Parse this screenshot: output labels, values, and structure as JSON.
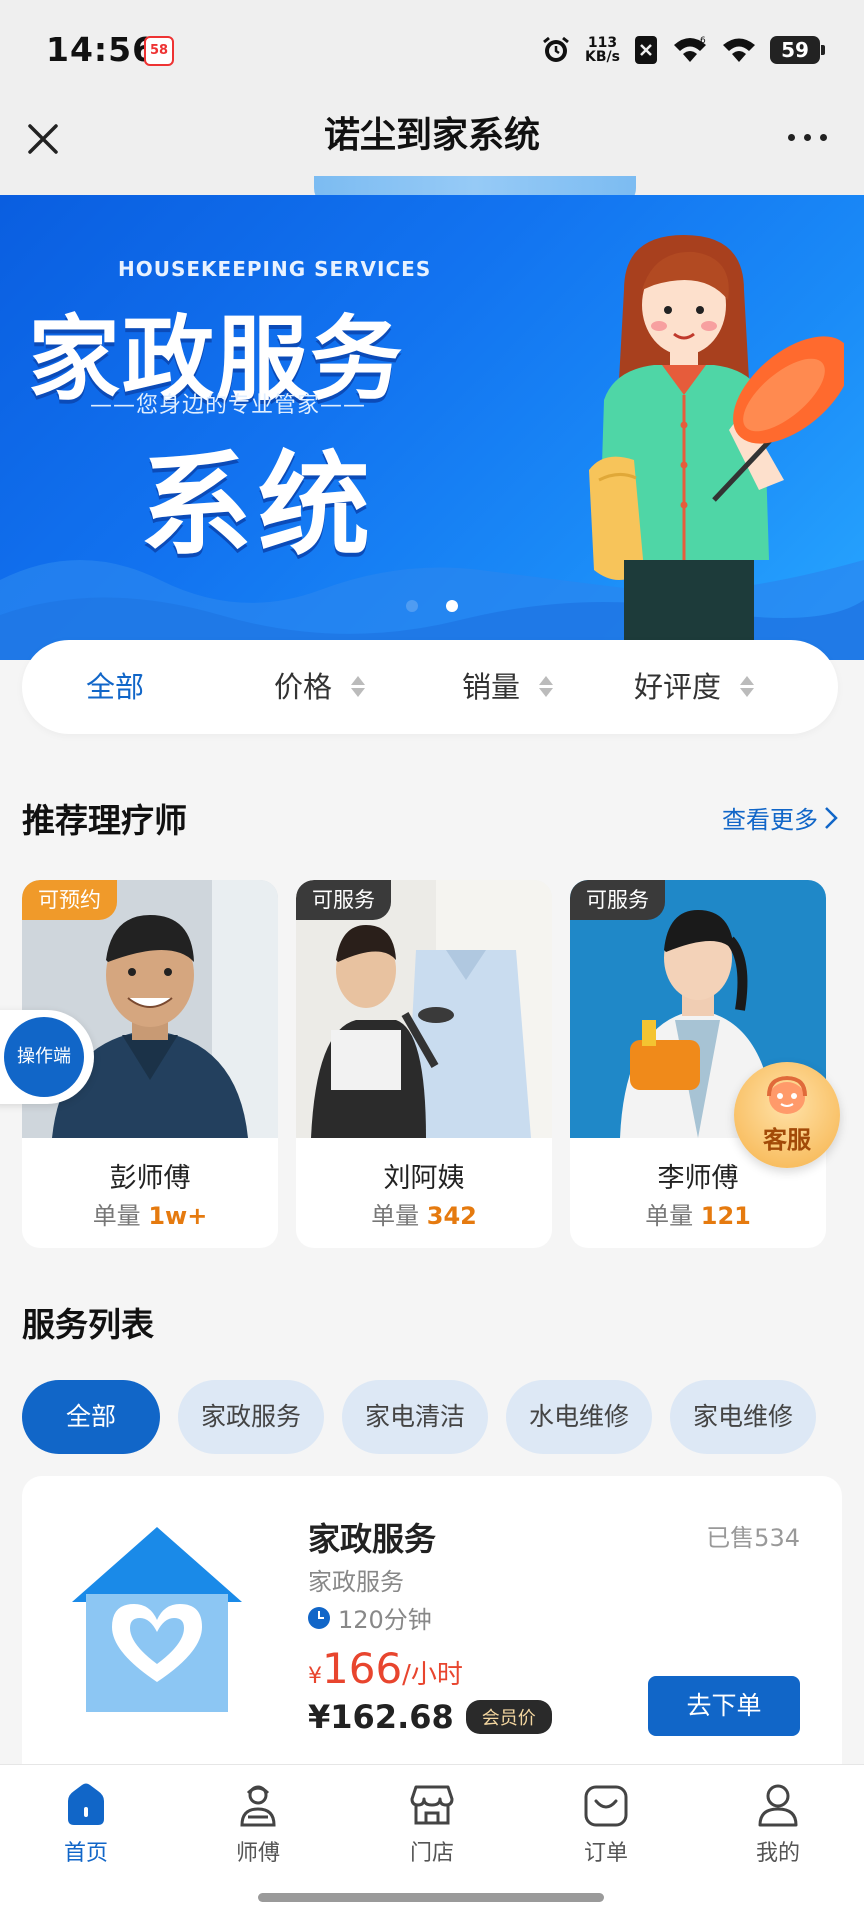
{
  "status_bar": {
    "time": "14:56",
    "app_badge": "58",
    "net_speed_value": "113",
    "net_speed_unit": "KB/s",
    "battery": "59",
    "icons": [
      "alarm-icon",
      "no-sim-icon",
      "wifi-6-icon",
      "wifi-icon"
    ]
  },
  "title_bar": {
    "title": "诺尘到家系统",
    "close_icon": "close-icon",
    "more_icon": "more-dots-icon"
  },
  "banner": {
    "subtitle_en": "HOUSEKEEPING SERVICES",
    "title": "家政服务",
    "tagline": "——您身边的专业管家——",
    "title2": "系统",
    "page_count": 2,
    "active_page": 2
  },
  "filter": {
    "items": [
      {
        "label": "全部",
        "active": true
      },
      {
        "label": "价格",
        "active": false
      },
      {
        "label": "销量",
        "active": false
      },
      {
        "label": "好评度",
        "active": false
      }
    ]
  },
  "recommend": {
    "title": "推荐理疗师",
    "see_more": "查看更多",
    "sales_prefix": "单量",
    "cards": [
      {
        "badge": "可预约",
        "name": "彭师傅",
        "sales": "1w+"
      },
      {
        "badge": "可服务",
        "name": "刘阿姨",
        "sales": "342"
      },
      {
        "badge": "可服务",
        "name": "李师傅",
        "sales": "121"
      }
    ]
  },
  "floating": {
    "operator": "操作端",
    "customer_service": "客服"
  },
  "service_list": {
    "title": "服务列表",
    "tabs": [
      "全部",
      "家政服务",
      "家电清洁",
      "水电维修",
      "家电维修"
    ],
    "active_tab": "全部",
    "item": {
      "title": "家政服务",
      "sold": "已售534",
      "category": "家政服务",
      "duration": "120分钟",
      "price_currency": "¥",
      "price": "166",
      "price_unit": "/小时",
      "member_price": "¥162.68",
      "member_tag": "会员价",
      "order_button": "去下单"
    }
  },
  "bottom_nav": {
    "items": [
      {
        "label": "首页",
        "icon": "home-icon",
        "active": true
      },
      {
        "label": "师傅",
        "icon": "worker-icon",
        "active": false
      },
      {
        "label": "门店",
        "icon": "store-icon",
        "active": false
      },
      {
        "label": "订单",
        "icon": "order-icon",
        "active": false
      },
      {
        "label": "我的",
        "icon": "profile-icon",
        "active": false
      }
    ]
  },
  "colors": {
    "primary": "#1166c8",
    "price": "#e8452e",
    "badge_orange": "#f09a2a",
    "badge_dark": "#3a3a3a",
    "sales_highlight": "#e57a0f"
  }
}
